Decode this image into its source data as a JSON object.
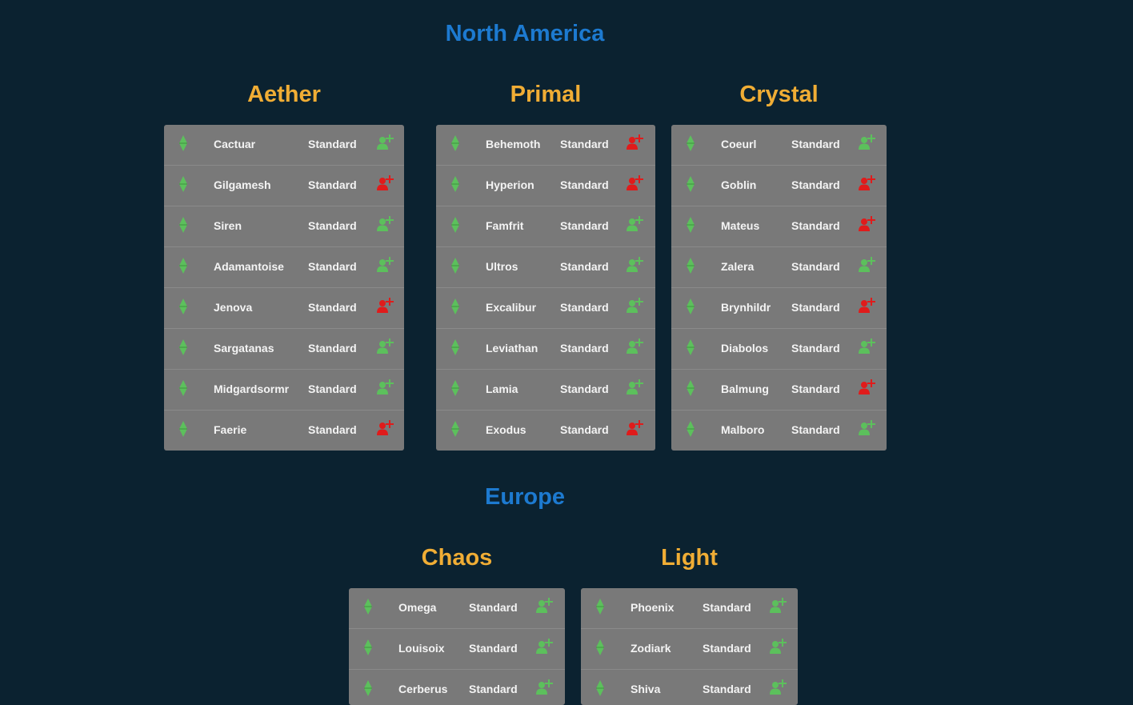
{
  "regions": [
    {
      "title": "North America",
      "datacenters": [
        {
          "name": "Aether",
          "worlds": [
            {
              "name": "Cactuar",
              "type": "Standard",
              "char_create": "available"
            },
            {
              "name": "Gilgamesh",
              "type": "Standard",
              "char_create": "unavailable"
            },
            {
              "name": "Siren",
              "type": "Standard",
              "char_create": "available"
            },
            {
              "name": "Adamantoise",
              "type": "Standard",
              "char_create": "available"
            },
            {
              "name": "Jenova",
              "type": "Standard",
              "char_create": "unavailable"
            },
            {
              "name": "Sargatanas",
              "type": "Standard",
              "char_create": "available"
            },
            {
              "name": "Midgardsormr",
              "type": "Standard",
              "char_create": "available"
            },
            {
              "name": "Faerie",
              "type": "Standard",
              "char_create": "unavailable"
            }
          ]
        },
        {
          "name": "Primal",
          "worlds": [
            {
              "name": "Behemoth",
              "type": "Standard",
              "char_create": "unavailable"
            },
            {
              "name": "Hyperion",
              "type": "Standard",
              "char_create": "unavailable"
            },
            {
              "name": "Famfrit",
              "type": "Standard",
              "char_create": "available"
            },
            {
              "name": "Ultros",
              "type": "Standard",
              "char_create": "available"
            },
            {
              "name": "Excalibur",
              "type": "Standard",
              "char_create": "available"
            },
            {
              "name": "Leviathan",
              "type": "Standard",
              "char_create": "available"
            },
            {
              "name": "Lamia",
              "type": "Standard",
              "char_create": "available"
            },
            {
              "name": "Exodus",
              "type": "Standard",
              "char_create": "unavailable"
            }
          ]
        },
        {
          "name": "Crystal",
          "worlds": [
            {
              "name": "Coeurl",
              "type": "Standard",
              "char_create": "available"
            },
            {
              "name": "Goblin",
              "type": "Standard",
              "char_create": "unavailable"
            },
            {
              "name": "Mateus",
              "type": "Standard",
              "char_create": "unavailable"
            },
            {
              "name": "Zalera",
              "type": "Standard",
              "char_create": "available"
            },
            {
              "name": "Brynhildr",
              "type": "Standard",
              "char_create": "unavailable"
            },
            {
              "name": "Diabolos",
              "type": "Standard",
              "char_create": "available"
            },
            {
              "name": "Balmung",
              "type": "Standard",
              "char_create": "unavailable"
            },
            {
              "name": "Malboro",
              "type": "Standard",
              "char_create": "available"
            }
          ]
        }
      ]
    },
    {
      "title": "Europe",
      "datacenters": [
        {
          "name": "Chaos",
          "worlds": [
            {
              "name": "Omega",
              "type": "Standard",
              "char_create": "available"
            },
            {
              "name": "Louisoix",
              "type": "Standard",
              "char_create": "available"
            },
            {
              "name": "Cerberus",
              "type": "Standard",
              "char_create": "available"
            }
          ]
        },
        {
          "name": "Light",
          "worlds": [
            {
              "name": "Phoenix",
              "type": "Standard",
              "char_create": "available"
            },
            {
              "name": "Zodiark",
              "type": "Standard",
              "char_create": "available"
            },
            {
              "name": "Shiva",
              "type": "Standard",
              "char_create": "available"
            }
          ]
        }
      ]
    }
  ],
  "colors": {
    "background": "#0b2230",
    "region_title": "#1d7ad0",
    "datacenter_title": "#f0ad35",
    "panel": "#797979",
    "status_online": "#5cc05c",
    "char_create_available": "#5cc05c",
    "char_create_unavailable": "#e01b1b"
  },
  "icons": {
    "status": "online-crystal-icon",
    "char_create": "add-user-icon"
  }
}
